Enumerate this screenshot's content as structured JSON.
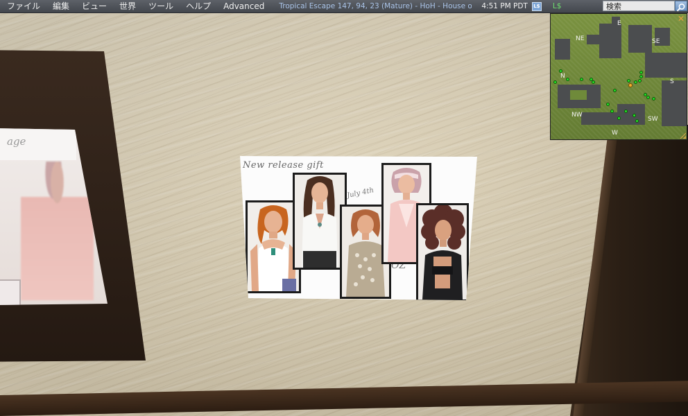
{
  "menubar": {
    "items": [
      "ファイル",
      "編集",
      "ビュー",
      "世界",
      "ツール",
      "ヘルプ",
      "Advanced"
    ],
    "location": "Tropical Escape 147, 94, 23 (Mature) - HoH - House o",
    "clock": "4:51 PM PDT",
    "buy_icon_label": "L$",
    "balance": "L$",
    "search_value": "検索"
  },
  "minimap": {
    "directions": {
      "n": "N",
      "ne": "NE",
      "e": "E",
      "se": "SE",
      "s": "S",
      "sw": "SW",
      "w": "W",
      "nw": "NW"
    },
    "close_label": "✕",
    "avatar_count_green": 20
  },
  "scene": {
    "poster": {
      "title": "New release gift",
      "date": "July 4th",
      "logo": "OZ"
    },
    "left_frame_header": "age"
  },
  "colors": {
    "menubar": "#4b4f55",
    "location_text": "#a9c3e7",
    "balance_text": "#6ee06e",
    "minimap_grass": "#6f8a3a",
    "avatar_dot": "#26e026",
    "self_dot": "#f0b030"
  },
  "icons": [
    "search-icon",
    "close-icon",
    "resize-grip-icon",
    "buy-currency-icon"
  ]
}
